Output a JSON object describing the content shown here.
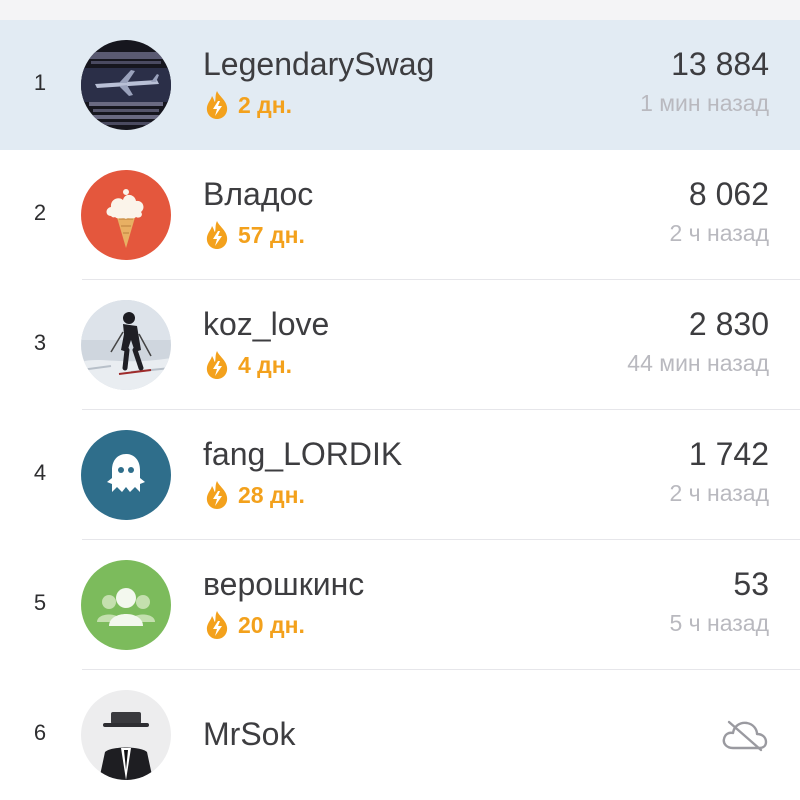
{
  "theme": {
    "highlight_bg": "#e2ebf3",
    "streak_color": "#f3a11c",
    "secondary_text": "#b9b9bf",
    "primary_text": "#3d3d40"
  },
  "leaderboard": {
    "rows": [
      {
        "rank": "1",
        "name": "LegendarySwag",
        "streak": "2 дн.",
        "score": "13 884",
        "time": "1 мин назад",
        "avatar": "airplane-poster-avatar",
        "highlighted": true
      },
      {
        "rank": "2",
        "name": "Владос",
        "streak": "57 дн.",
        "score": "8 062",
        "time": "2 ч назад",
        "avatar": "ice-cream-avatar"
      },
      {
        "rank": "3",
        "name": "koz_love",
        "streak": "4 дн.",
        "score": "2 830",
        "time": "44 мин назад",
        "avatar": "skier-photo-avatar"
      },
      {
        "rank": "4",
        "name": "fang_LORDIK",
        "streak": "28 дн.",
        "score": "1 742",
        "time": "2 ч назад",
        "avatar": "ghost-avatar"
      },
      {
        "rank": "5",
        "name": "верошкинс",
        "streak": "20 дн.",
        "score": "53",
        "time": "5 ч назад",
        "avatar": "group-avatar"
      },
      {
        "rank": "6",
        "name": "MrSok",
        "status_icon": "cloud-off-icon",
        "avatar": "hat-man-avatar"
      }
    ]
  }
}
